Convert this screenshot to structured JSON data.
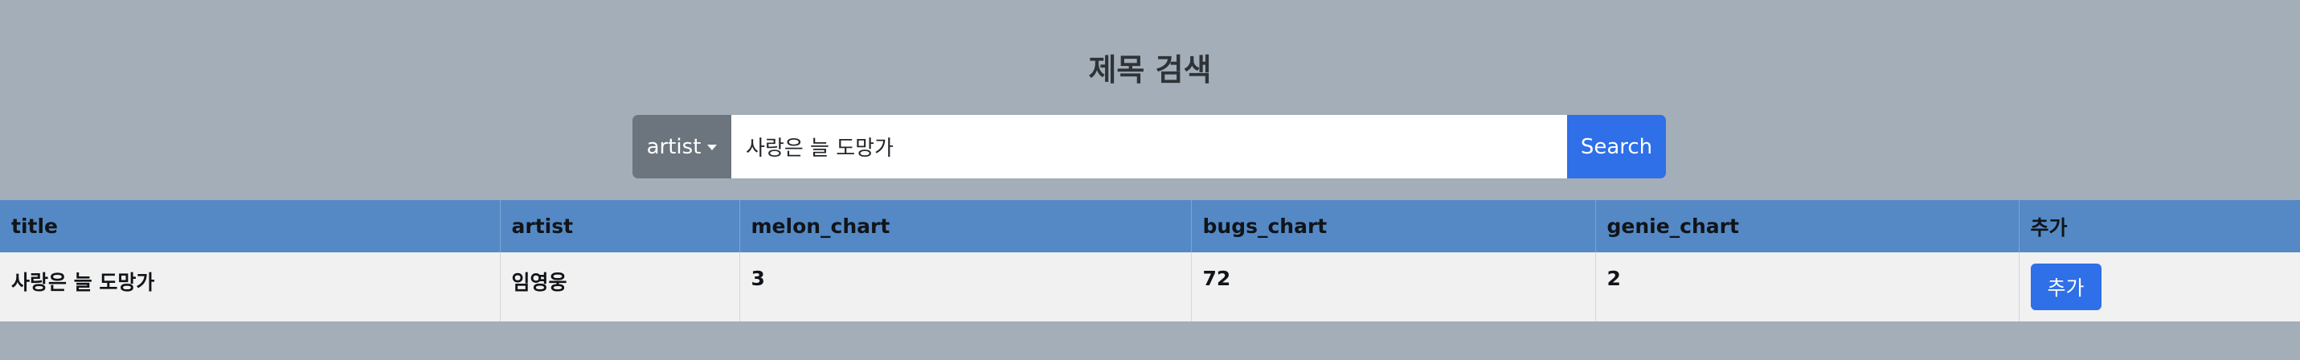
{
  "page": {
    "title": "제목 검색"
  },
  "search": {
    "dropdown_label": "artist",
    "query": "사랑은 늘 도망가",
    "button_label": "Search"
  },
  "table": {
    "headers": [
      "title",
      "artist",
      "melon_chart",
      "bugs_chart",
      "genie_chart",
      "추가"
    ],
    "rows": [
      {
        "title": "사랑은 늘 도망가",
        "artist": "임영웅",
        "melon_chart": "3",
        "bugs_chart": "72",
        "genie_chart": "2",
        "add_label": "추가"
      }
    ]
  }
}
